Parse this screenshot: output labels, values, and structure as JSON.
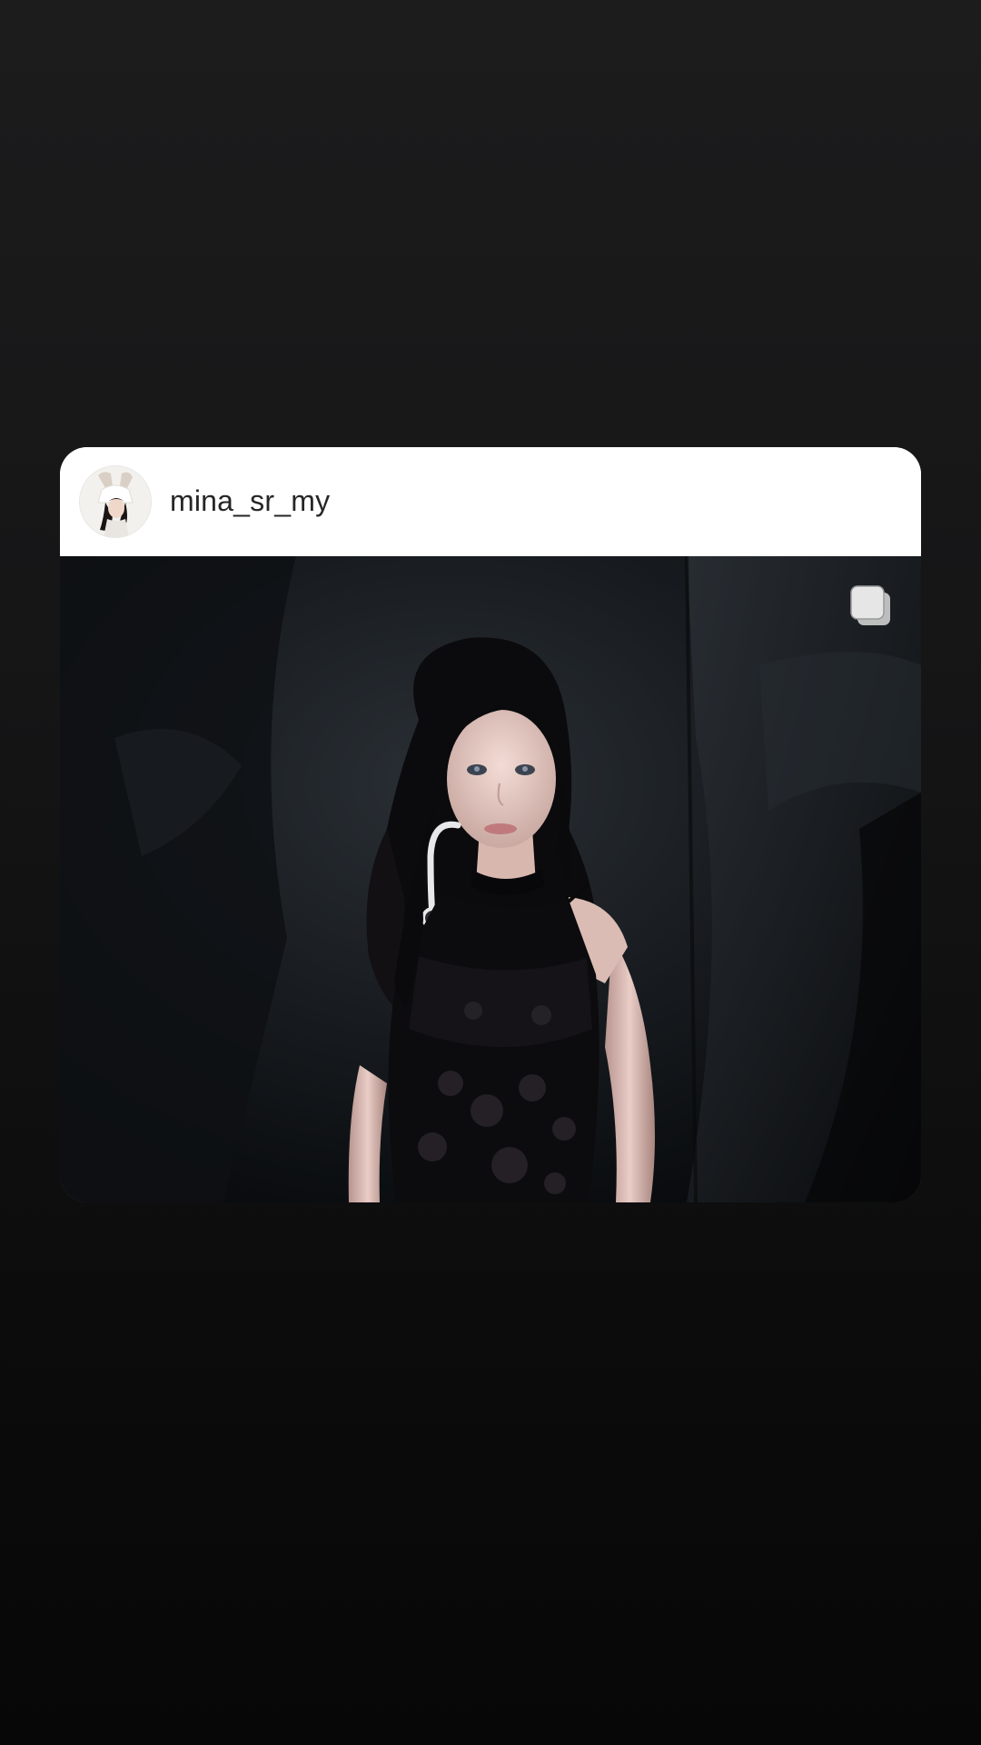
{
  "post": {
    "username": "mina_sr_my",
    "avatar_icon": "profile-photo",
    "media_description_icon": "photo",
    "multi_photo_icon": "carousel-stack-icon"
  },
  "colors": {
    "header_bg": "#ffffff",
    "username_text": "#262626",
    "page_bg_top": "#1c1c1d",
    "page_bg_bottom": "#070707"
  }
}
